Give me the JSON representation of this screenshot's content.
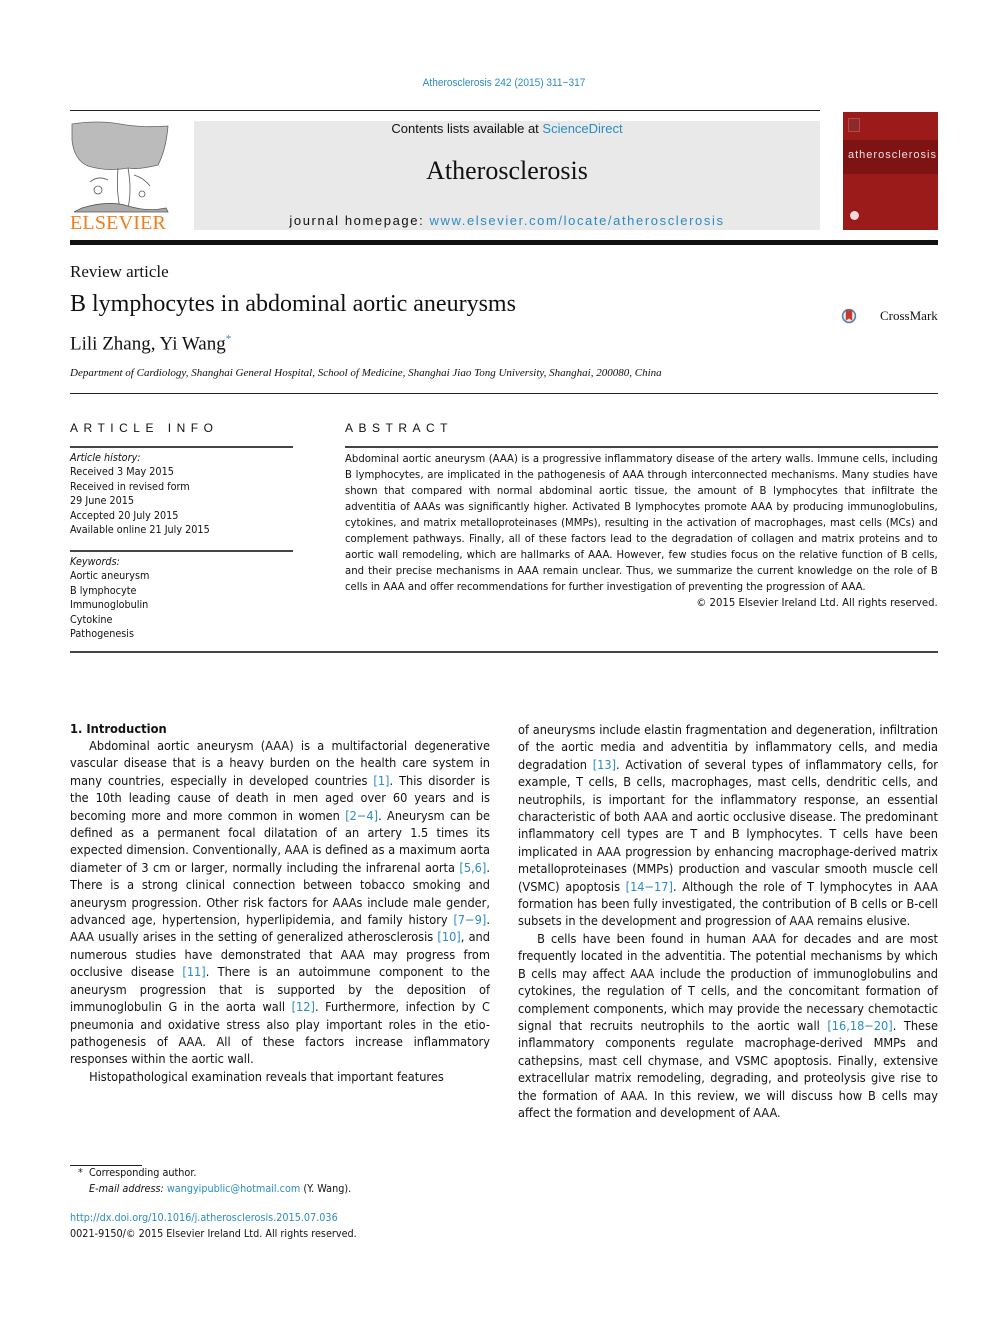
{
  "header": {
    "journal_ref": "Atherosclerosis 242 (2015) 311−317",
    "contents_prefix": "Contents lists available at ",
    "contents_link": "ScienceDirect",
    "journal_name": "Atherosclerosis",
    "homepage_prefix": "journal homepage: ",
    "homepage_link": "www.elsevier.com/locate/atherosclerosis",
    "publisher_logo_text": "ELSEVIER",
    "cover_title": "atherosclerosis",
    "crossmark_label": "CrossMark"
  },
  "article": {
    "type": "Review article",
    "title": "B lymphocytes in abdominal aortic aneurysms",
    "authors": "Lili Zhang, Yi Wang",
    "author_mark": "*",
    "affiliation": "Department of Cardiology, Shanghai General Hospital, School of Medicine, Shanghai Jiao Tong University, Shanghai, 200080, China"
  },
  "article_info": {
    "heading": "ARTICLE INFO",
    "history_label": "Article history:",
    "history": [
      "Received 3 May 2015",
      "Received in revised form",
      "29 June 2015",
      "Accepted 20 July 2015",
      "Available online 21 July 2015"
    ],
    "keywords_label": "Keywords:",
    "keywords": [
      "Aortic aneurysm",
      "B lymphocyte",
      "Immunoglobulin",
      "Cytokine",
      "Pathogenesis"
    ]
  },
  "abstract": {
    "heading": "ABSTRACT",
    "text": "Abdominal aortic aneurysm (AAA) is a progressive inflammatory disease of the artery walls. Immune cells, including B lymphocytes, are implicated in the pathogenesis of AAA through interconnected mechanisms. Many studies have shown that compared with normal abdominal aortic tissue, the amount of B lymphocytes that infiltrate the adventitia of AAAs was significantly higher. Activated B lymphocytes promote AAA by producing immunoglobulins, cytokines, and matrix metalloproteinases (MMPs), resulting in the activation of macrophages, mast cells (MCs) and complement pathways. Finally, all of these factors lead to the degradation of collagen and matrix proteins and to aortic wall remodeling, which are hallmarks of AAA. However, few studies focus on the relative function of B cells, and their precise mechanisms in AAA remain unclear. Thus, we summarize the current knowledge on the role of B cells in AAA and offer recommendations for further investigation of preventing the progression of AAA.",
    "copyright": "© 2015 Elsevier Ireland Ltd. All rights reserved."
  },
  "body": {
    "section_title": "1.  Introduction",
    "paragraphs": [
      {
        "indent": true,
        "segments": [
          {
            "t": "Abdominal aortic aneurysm (AAA) is a multifactorial degenerative vascular disease that is a heavy burden on the health care system in many countries, especially in developed countries "
          },
          {
            "ref": "[1]"
          },
          {
            "t": ". This disorder is the 10th leading cause of death in men aged over 60 years and is becoming more and more common in women "
          },
          {
            "ref": "[2−4]"
          },
          {
            "t": ". Aneurysm can be defined as a permanent focal dilatation of an artery 1.5 times its expected dimension. Conventionally, AAA is defined as a maximum aorta diameter of 3 cm or larger, normally including the infrarenal aorta "
          },
          {
            "ref": "[5,6]"
          },
          {
            "t": ". There is a strong clinical connection between tobacco smoking and aneurysm progression. Other risk factors for AAAs include male gender, advanced age, hypertension, hyperlipidemia, and family history "
          },
          {
            "ref": "[7−9]"
          },
          {
            "t": ". AAA usually arises in the setting of generalized atherosclerosis "
          },
          {
            "ref": "[10]"
          },
          {
            "t": ", and numerous studies have demonstrated that AAA may progress from occlusive disease "
          },
          {
            "ref": "[11]"
          },
          {
            "t": ". There is an autoimmune component to the aneurysm progression that is supported by the deposition of immunoglobulin G in the aorta wall "
          },
          {
            "ref": "[12]"
          },
          {
            "t": ". Furthermore, infection by C pneumonia and oxidative stress also play important roles in the etio-pathogenesis of AAA. All of these factors increase inflammatory responses within the aortic wall."
          }
        ]
      },
      {
        "indent": true,
        "segments": [
          {
            "t": "Histopathological examination reveals that important features"
          }
        ]
      }
    ],
    "right_paragraphs": [
      {
        "indent": false,
        "segments": [
          {
            "t": "of aneurysms include elastin fragmentation and degeneration, infiltration of the aortic media and adventitia by inflammatory cells, and media degradation "
          },
          {
            "ref": "[13]"
          },
          {
            "t": ". Activation of several types of inflammatory cells, for example, T cells, B cells, macrophages, mast cells, dendritic cells, and neutrophils, is important for the inflammatory response, an essential characteristic of both AAA and aortic occlusive disease. The predominant inflammatory cell types are T and B lymphocytes. T cells have been implicated in AAA progression by enhancing macrophage-derived matrix metalloproteinases (MMPs) production and vascular smooth muscle cell (VSMC) apoptosis "
          },
          {
            "ref": "[14−17]"
          },
          {
            "t": ". Although the role of T lymphocytes in AAA formation has been fully investigated, the contribution of B cells or B-cell subsets in the development and progression of AAA remains elusive."
          }
        ]
      },
      {
        "indent": true,
        "segments": [
          {
            "t": "B cells have been found in human AAA for decades and are most frequently located in the adventitia. The potential mechanisms by which B cells may affect AAA include the production of immunoglobulins and cytokines, the regulation of T cells, and the concomitant formation of complement components, which may provide the necessary chemotactic signal that recruits neutrophils to the aortic wall "
          },
          {
            "ref": "[16,18−20]"
          },
          {
            "t": ". These inflammatory components regulate macrophage-derived MMPs and cathepsins, mast cell chymase, and VSMC apoptosis. Finally, extensive extracellular matrix remodeling, degrading, and proteolysis give rise to the formation of AAA. In this review, we will discuss how B cells may affect the formation and development of AAA."
          }
        ]
      }
    ]
  },
  "footnote": {
    "mark": "*",
    "corresponding": "Corresponding author.",
    "email_label": "E-mail address: ",
    "email": "wangyipublic@hotmail.com",
    "email_suffix": " (Y. Wang).",
    "doi": "http://dx.doi.org/10.1016/j.atherosclerosis.2015.07.036",
    "issn_line": "0021-9150/© 2015 Elsevier Ireland Ltd. All rights reserved."
  },
  "colors": {
    "link": "#2a8cc4",
    "publisher_orange": "#f07d1a",
    "cover_red": "#9b1b1b",
    "banner_gray": "#e9e9e9"
  }
}
